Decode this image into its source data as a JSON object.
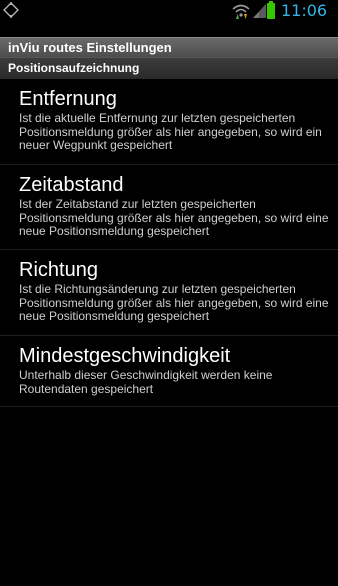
{
  "status_bar": {
    "time": "11:06",
    "icons": [
      "gps-icon",
      "wifi-icon",
      "signal-icon",
      "battery-icon"
    ],
    "time_color": "#33b5e5",
    "battery_color": "#35c800"
  },
  "title_bar": {
    "title": "inViu routes Einstellungen"
  },
  "category": {
    "label": "Positionsaufzeichnung"
  },
  "preferences": [
    {
      "title": "Entfernung",
      "summary": "Ist die aktuelle Entfernung zur letzten gespeicherten Positionsmeldung größer als hier angegeben, so wird ein neuer Wegpunkt gespeichert"
    },
    {
      "title": "Zeitabstand",
      "summary": "Ist der Zeitabstand zur letzten gespeicherten Positionsmeldung größer als hier angegeben, so wird eine neue Positionsmeldung gespeichert"
    },
    {
      "title": "Richtung",
      "summary": "Ist die Richtungsänderung zur letzten gespeicherten Positionsmeldung größer als hier angegeben, so wird eine neue Positionsmeldung gespeichert"
    },
    {
      "title": "Mindestgeschwindigkeit",
      "summary": "Unterhalb dieser Geschwindigkeit werden keine Routendaten gespeichert"
    }
  ]
}
